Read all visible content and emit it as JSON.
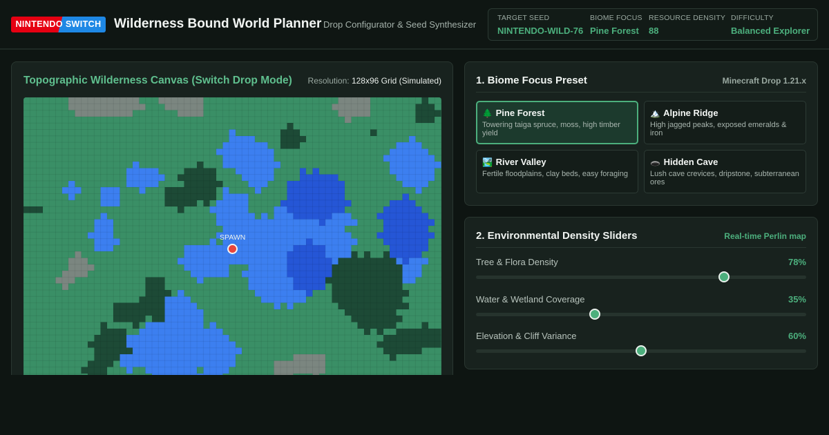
{
  "header": {
    "badge": "NINTENDO SWITCH",
    "title": "Wilderness Bound World Planner",
    "subtitle": "Drop Configurator & Seed Synthesizer",
    "stats": [
      {
        "label": "TARGET SEED",
        "value": "NINTENDO-WILD-76"
      },
      {
        "label": "BIOME FOCUS",
        "value": "Pine Forest"
      },
      {
        "label": "RESOURCE DENSITY",
        "value": "88"
      },
      {
        "label": "DIFFICULTY",
        "value": "Balanced Explorer"
      }
    ]
  },
  "canvas": {
    "title": "Topographic Wilderness Canvas (Switch Drop Mode)",
    "resolution_label": "Resolution:",
    "resolution_value": "128x96 Grid (Simulated)",
    "spawn_label": "SPAWN",
    "legend_colors": {
      "grass": "#3a8f66",
      "forest": "#1d4a36",
      "water": "#3c7ff0",
      "deep_water": "#2556d6",
      "stone": "#7b8680"
    }
  },
  "biome_panel": {
    "title": "1. Biome Focus Preset",
    "meta": "Minecraft Drop 1.21.x",
    "presets": [
      {
        "icon": "🌲",
        "name": "Pine Forest",
        "desc": "Towering taiga spruce, moss, high timber yield",
        "selected": true
      },
      {
        "icon": "🏔️",
        "name": "Alpine Ridge",
        "desc": "High jagged peaks, exposed emeralds & iron",
        "selected": false
      },
      {
        "icon": "🏞️",
        "name": "River Valley",
        "desc": "Fertile floodplains, clay beds, easy foraging",
        "selected": false
      },
      {
        "icon": "🕳️",
        "name": "Hidden Cave",
        "desc": "Lush cave crevices, dripstone, subterranean ores",
        "selected": false
      }
    ]
  },
  "density_panel": {
    "title": "2. Environmental Density Sliders",
    "meta": "Real-time Perlin map",
    "sliders": [
      {
        "label": "Tree & Flora Density",
        "value_text": "78%",
        "value": 0.75
      },
      {
        "label": "Water & Wetland Coverage",
        "value_text": "35%",
        "value": 0.36
      },
      {
        "label": "Elevation & Cliff Variance",
        "value_text": "60%",
        "value": 0.5
      }
    ]
  }
}
